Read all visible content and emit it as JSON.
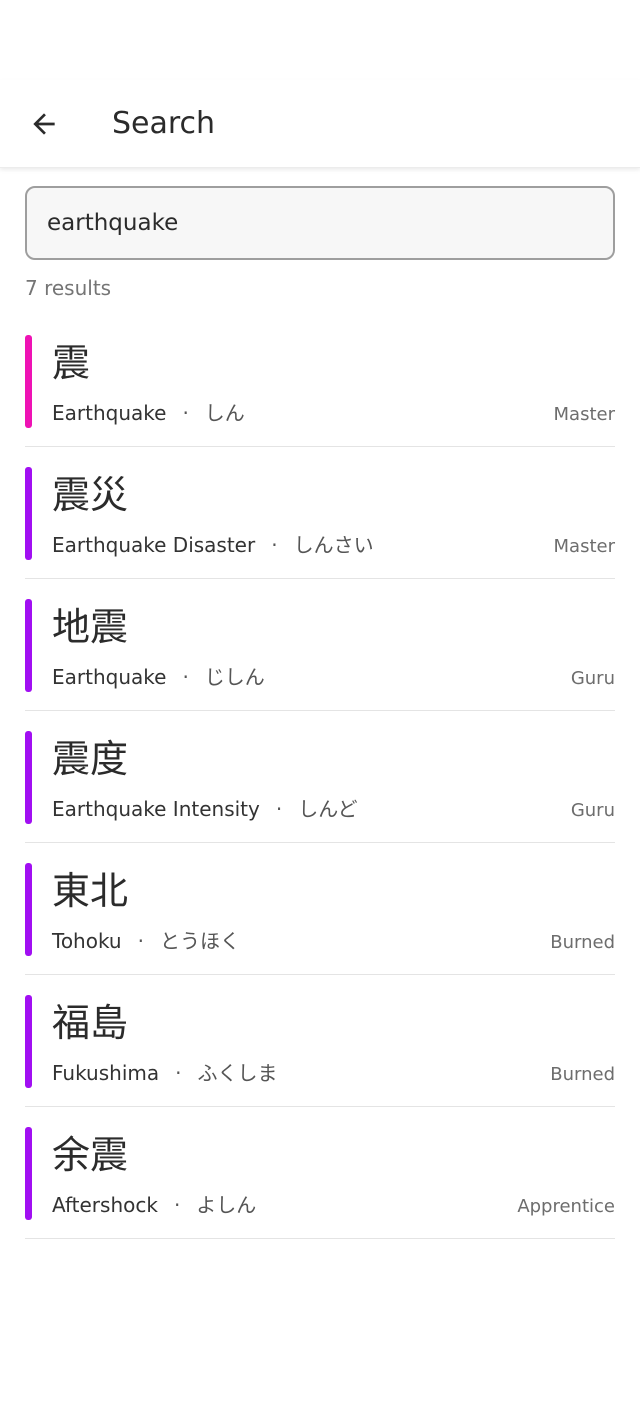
{
  "header": {
    "title": "Search"
  },
  "search": {
    "value": "earthquake",
    "placeholder": ""
  },
  "results_count": "7 results",
  "colors": {
    "srs_master": "#ee12b4",
    "srs_purple": "#a10ff2"
  },
  "results": [
    {
      "kanji": "震",
      "meaning": "Earthquake",
      "separator": "·",
      "reading": "しん",
      "level": "Master",
      "color": "#ee12b4"
    },
    {
      "kanji": "震災",
      "meaning": "Earthquake Disaster",
      "separator": "·",
      "reading": "しんさい",
      "level": "Master",
      "color": "#a10ff2"
    },
    {
      "kanji": "地震",
      "meaning": "Earthquake",
      "separator": "·",
      "reading": "じしん",
      "level": "Guru",
      "color": "#a10ff2"
    },
    {
      "kanji": "震度",
      "meaning": "Earthquake Intensity",
      "separator": "·",
      "reading": "しんど",
      "level": "Guru",
      "color": "#a10ff2"
    },
    {
      "kanji": "東北",
      "meaning": "Tohoku",
      "separator": "·",
      "reading": "とうほく",
      "level": "Burned",
      "color": "#a10ff2"
    },
    {
      "kanji": "福島",
      "meaning": "Fukushima",
      "separator": "·",
      "reading": "ふくしま",
      "level": "Burned",
      "color": "#a10ff2"
    },
    {
      "kanji": "余震",
      "meaning": "Aftershock",
      "separator": "·",
      "reading": "よしん",
      "level": "Apprentice",
      "color": "#a10ff2"
    }
  ]
}
